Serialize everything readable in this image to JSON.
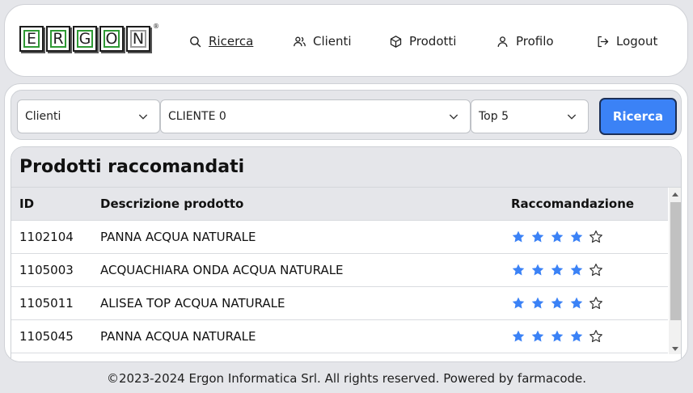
{
  "brand": {
    "letters": [
      "E",
      "R",
      "G",
      "O",
      "N"
    ],
    "registered": "®"
  },
  "nav": {
    "search": "Ricerca",
    "clients": "Clienti",
    "products": "Prodotti",
    "profile": "Profilo",
    "logout": "Logout"
  },
  "filters": {
    "type_selected": "Clienti",
    "client_selected": "CLIENTE 0",
    "top_selected": "Top 5",
    "search_button": "Ricerca"
  },
  "card": {
    "title": "Prodotti raccomandati",
    "columns": [
      "ID",
      "Descrizione prodotto",
      "Raccomandazione"
    ],
    "rows": [
      {
        "id": "1102104",
        "description": "PANNA ACQUA NATURALE",
        "rating": 4,
        "max": 5
      },
      {
        "id": "1105003",
        "description": "ACQUACHIARA ONDA ACQUA NATURALE",
        "rating": 4,
        "max": 5
      },
      {
        "id": "1105011",
        "description": "ALISEA TOP ACQUA NATURALE",
        "rating": 4,
        "max": 5
      },
      {
        "id": "1105045",
        "description": "PANNA ACQUA NATURALE",
        "rating": 4,
        "max": 5
      }
    ]
  },
  "footer": "©2023-2024 Ergon Informatica Srl. All rights reserved. Powered by farmacode.",
  "colors": {
    "accent": "#3b82f6",
    "logo_green": "#2f9a34",
    "background": "#e5e6ea"
  }
}
